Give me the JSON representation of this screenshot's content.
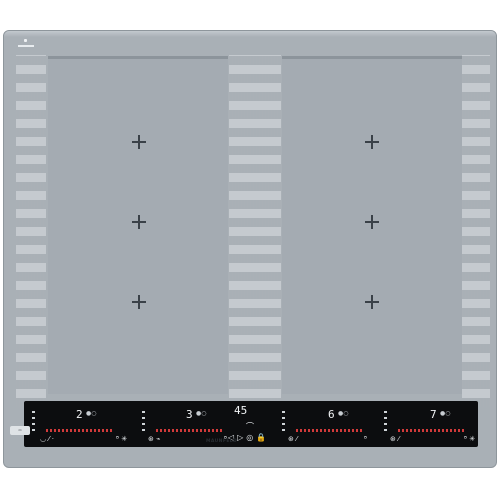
{
  "panel": {
    "zones": [
      {
        "level": "2"
      },
      {
        "level": "3"
      },
      {
        "level": "6"
      },
      {
        "level": "7"
      }
    ],
    "timer": "45"
  },
  "branding": {
    "name": "MAUNFELD"
  }
}
